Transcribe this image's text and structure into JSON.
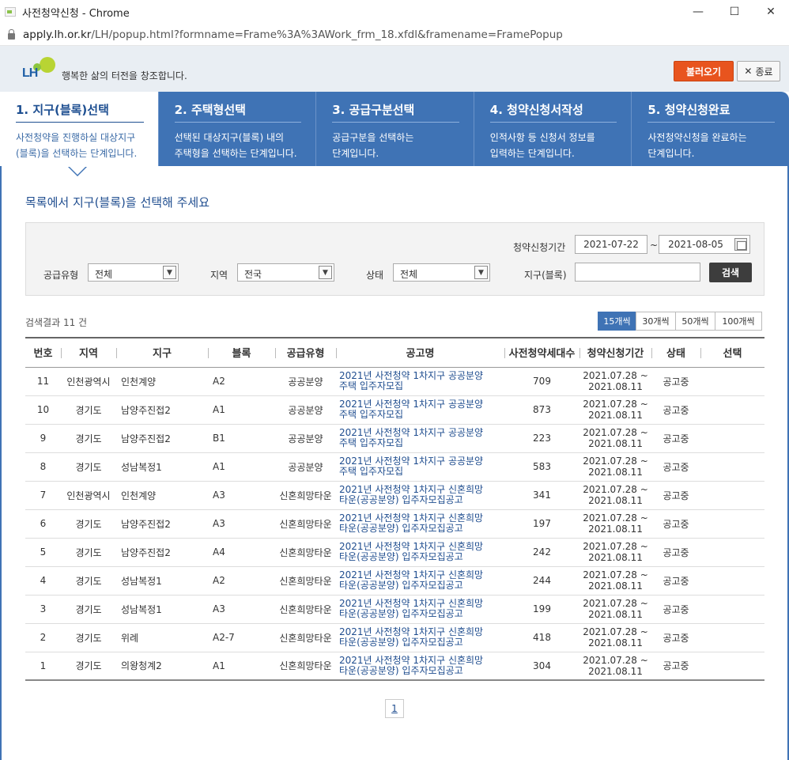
{
  "window": {
    "title": "사전청약신청 - Chrome",
    "url_host": "apply.lh.or.kr",
    "url_path": "/LH/popup.html?formname=Frame%3A%3AWork_frm_18.xfdl&framename=FramePopup",
    "minimize": "—",
    "maximize": "☐",
    "close": "✕"
  },
  "header": {
    "logo_text": "LH",
    "slogan": "행복한 삶의 터전을 창조합니다.",
    "load_button": "불러오기",
    "close_button": "종료",
    "close_x": "✕"
  },
  "steps": [
    {
      "title": "1. 지구(블록)선택",
      "desc1": "사전청약을 진행하실 대상지구",
      "desc2": "(블록)을 선택하는 단계입니다."
    },
    {
      "title": "2. 주택형선택",
      "desc1": "선택된 대상지구(블록) 내의",
      "desc2": "주택형을 선택하는 단계입니다."
    },
    {
      "title": "3. 공급구분선택",
      "desc1": "공급구분을 선택하는",
      "desc2": "단계입니다."
    },
    {
      "title": "4. 청약신청서작성",
      "desc1": "인적사항 등 신청서 정보를",
      "desc2": "입력하는 단계입니다."
    },
    {
      "title": "5. 청약신청완료",
      "desc1": "사전청약신청을 완료하는",
      "desc2": "단계입니다."
    }
  ],
  "main": {
    "heading": "목록에서 지구(블록)을 선택해 주세요"
  },
  "search": {
    "period_label": "청약신청기간",
    "date_from": "2021-07-22",
    "tilde": "~",
    "date_to": "2021-08-05",
    "supply_label": "공급유형",
    "supply_value": "전체",
    "region_label": "지역",
    "region_value": "전국",
    "status_label": "상태",
    "status_value": "전체",
    "district_label": "지구(블록)",
    "district_value": "",
    "search_button": "검색",
    "arrow": "▼"
  },
  "results": {
    "count_text": "검색결과 11 건",
    "page_sizes": [
      "15개씩",
      "30개씩",
      "50개씩",
      "100개씩"
    ],
    "selected_size": "15개씩"
  },
  "table": {
    "headers": [
      "번호",
      "지역",
      "지구",
      "블록",
      "공급유형",
      "공고명",
      "사전청약세대수",
      "청약신청기간",
      "상태",
      "선택"
    ],
    "rows": [
      {
        "no": "11",
        "region": "인천광역시",
        "district": "인천계양",
        "block": "A2",
        "type": "공공분양",
        "notice1": "2021년 사전청약 1차지구 공공분양",
        "notice2": "주택 입주자모집",
        "units": "709",
        "p1": "2021.07.28 ~",
        "p2": "2021.08.11",
        "status": "공고중"
      },
      {
        "no": "10",
        "region": "경기도",
        "district": "남양주진접2",
        "block": "A1",
        "type": "공공분양",
        "notice1": "2021년 사전청약 1차지구 공공분양",
        "notice2": "주택 입주자모집",
        "units": "873",
        "p1": "2021.07.28 ~",
        "p2": "2021.08.11",
        "status": "공고중"
      },
      {
        "no": "9",
        "region": "경기도",
        "district": "남양주진접2",
        "block": "B1",
        "type": "공공분양",
        "notice1": "2021년 사전청약 1차지구 공공분양",
        "notice2": "주택 입주자모집",
        "units": "223",
        "p1": "2021.07.28 ~",
        "p2": "2021.08.11",
        "status": "공고중"
      },
      {
        "no": "8",
        "region": "경기도",
        "district": "성남복정1",
        "block": "A1",
        "type": "공공분양",
        "notice1": "2021년 사전청약 1차지구 공공분양",
        "notice2": "주택 입주자모집",
        "units": "583",
        "p1": "2021.07.28 ~",
        "p2": "2021.08.11",
        "status": "공고중"
      },
      {
        "no": "7",
        "region": "인천광역시",
        "district": "인천계양",
        "block": "A3",
        "type": "신혼희망타운",
        "notice1": "2021년 사전청약 1차지구 신혼희망",
        "notice2": "타운(공공분양) 입주자모집공고",
        "units": "341",
        "p1": "2021.07.28 ~",
        "p2": "2021.08.11",
        "status": "공고중"
      },
      {
        "no": "6",
        "region": "경기도",
        "district": "남양주진접2",
        "block": "A3",
        "type": "신혼희망타운",
        "notice1": "2021년 사전청약 1차지구 신혼희망",
        "notice2": "타운(공공분양) 입주자모집공고",
        "units": "197",
        "p1": "2021.07.28 ~",
        "p2": "2021.08.11",
        "status": "공고중"
      },
      {
        "no": "5",
        "region": "경기도",
        "district": "남양주진접2",
        "block": "A4",
        "type": "신혼희망타운",
        "notice1": "2021년 사전청약 1차지구 신혼희망",
        "notice2": "타운(공공분양) 입주자모집공고",
        "units": "242",
        "p1": "2021.07.28 ~",
        "p2": "2021.08.11",
        "status": "공고중"
      },
      {
        "no": "4",
        "region": "경기도",
        "district": "성남복정1",
        "block": "A2",
        "type": "신혼희망타운",
        "notice1": "2021년 사전청약 1차지구 신혼희망",
        "notice2": "타운(공공분양) 입주자모집공고",
        "units": "244",
        "p1": "2021.07.28 ~",
        "p2": "2021.08.11",
        "status": "공고중"
      },
      {
        "no": "3",
        "region": "경기도",
        "district": "성남복정1",
        "block": "A3",
        "type": "신혼희망타운",
        "notice1": "2021년 사전청약 1차지구 신혼희망",
        "notice2": "타운(공공분양) 입주자모집공고",
        "units": "199",
        "p1": "2021.07.28 ~",
        "p2": "2021.08.11",
        "status": "공고중"
      },
      {
        "no": "2",
        "region": "경기도",
        "district": "위례",
        "block": "A2-7",
        "type": "신혼희망타운",
        "notice1": "2021년 사전청약 1차지구 신혼희망",
        "notice2": "타운(공공분양) 입주자모집공고",
        "units": "418",
        "p1": "2021.07.28 ~",
        "p2": "2021.08.11",
        "status": "공고중"
      },
      {
        "no": "1",
        "region": "경기도",
        "district": "의왕청계2",
        "block": "A1",
        "type": "신혼희망타운",
        "notice1": "2021년 사전청약 1차지구 신혼희망",
        "notice2": "타운(공공분양) 입주자모집공고",
        "units": "304",
        "p1": "2021.07.28 ~",
        "p2": "2021.08.11",
        "status": "공고중"
      }
    ]
  },
  "pagination": {
    "current": "1"
  },
  "colors": {
    "primary_blue": "#3f73b5",
    "accent_orange": "#e8541e",
    "header_bg": "#e9eef3"
  }
}
